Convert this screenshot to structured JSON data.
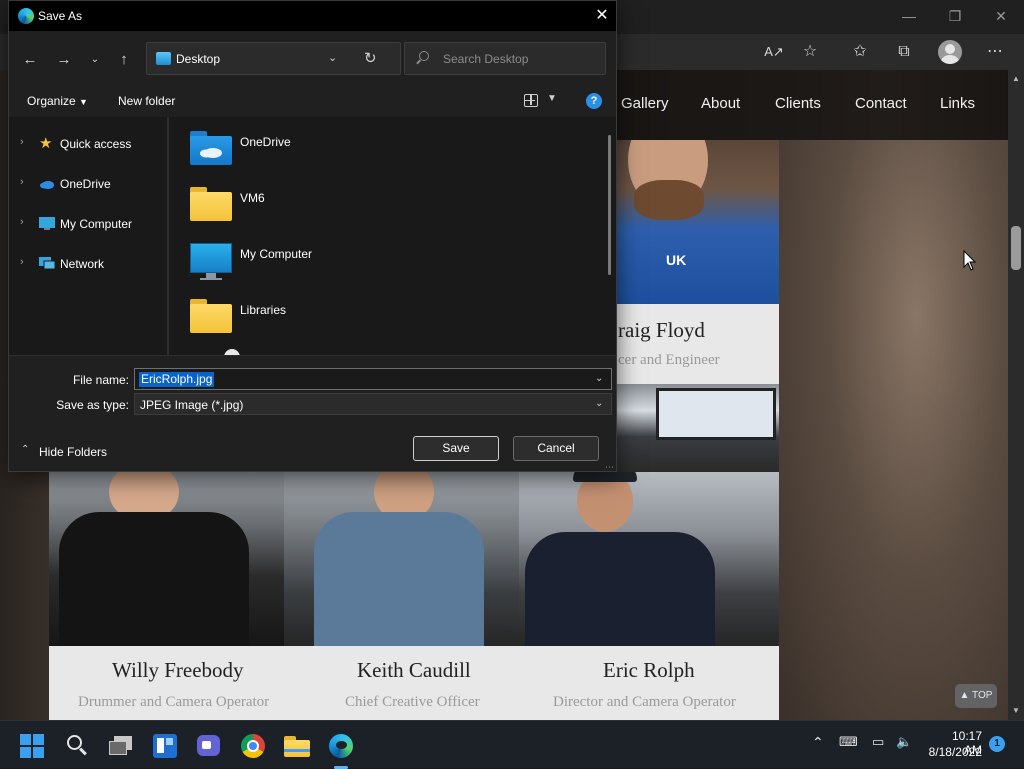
{
  "browser": {
    "toolbar_icons": [
      "read-aloud-icon",
      "add-favorite-icon",
      "favorites-icon",
      "collections-icon",
      "profile-icon",
      "more-icon"
    ],
    "window_controls": [
      "minimize",
      "restore",
      "close"
    ]
  },
  "site": {
    "nav": [
      "Gallery",
      "About",
      "Clients",
      "Contact",
      "Links"
    ],
    "featured": {
      "name_partial": "raig Floyd",
      "role_partial": "cer and Engineer"
    },
    "team": [
      {
        "name": "Willy Freebody",
        "role": "Drummer and Camera Operator"
      },
      {
        "name": "Keith Caudill",
        "role": "Chief Creative Officer"
      },
      {
        "name": "Eric Rolph",
        "role": "Director and Camera Operator"
      }
    ],
    "top_button": "TOP"
  },
  "dialog": {
    "title": "Save As",
    "address": "Desktop",
    "search_placeholder": "Search Desktop",
    "organize_label": "Organize",
    "new_folder_label": "New folder",
    "nav_tree": [
      {
        "label": "Quick access",
        "icon": "star-icon"
      },
      {
        "label": "OneDrive",
        "icon": "cloud-icon"
      },
      {
        "label": "My Computer",
        "icon": "monitor-icon"
      },
      {
        "label": "Network",
        "icon": "network-icon"
      }
    ],
    "files": [
      {
        "label": "OneDrive",
        "icon": "onedrive-folder-icon"
      },
      {
        "label": "VM6",
        "icon": "folder-icon"
      },
      {
        "label": "My Computer",
        "icon": "monitor-icon"
      },
      {
        "label": "Libraries",
        "icon": "folder-icon"
      }
    ],
    "file_name_label": "File name:",
    "file_name_value": "EricRolph.jpg",
    "save_type_label": "Save as type:",
    "save_type_value": "JPEG Image (*.jpg)",
    "hide_folders_label": "Hide Folders",
    "save_label": "Save",
    "cancel_label": "Cancel"
  },
  "taskbar": {
    "apps": [
      "start-icon",
      "search-icon",
      "task-view-icon",
      "widgets-icon",
      "teams-chat-icon",
      "chrome-icon",
      "file-explorer-icon",
      "edge-icon"
    ],
    "time": "10:17 AM",
    "date": "8/18/2022",
    "notification_count": "1"
  },
  "colors": {
    "accent": "#0a64c8",
    "dialog_bg": "#202020",
    "caption_card": "#e8e8e8"
  }
}
